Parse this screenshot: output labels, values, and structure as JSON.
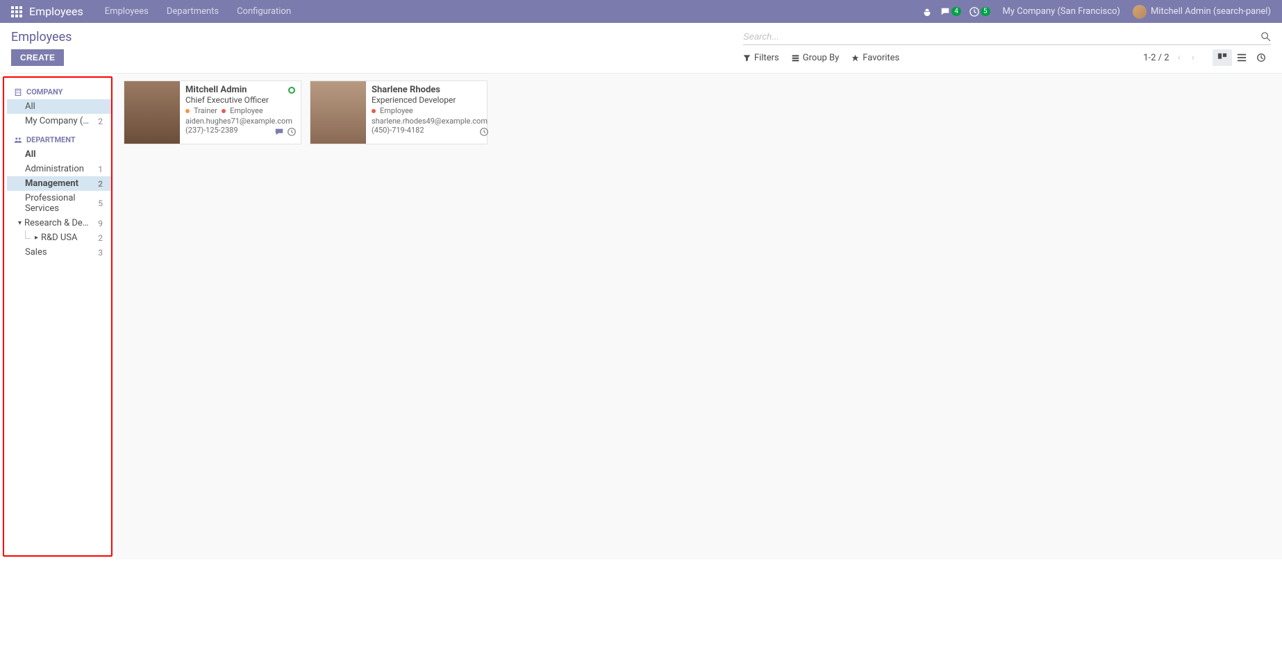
{
  "navbar": {
    "brand": "Employees",
    "links": [
      "Employees",
      "Departments",
      "Configuration"
    ],
    "chat_badge": "4",
    "clock_badge": "5",
    "company": "My Company (San Francisco)",
    "user": "Mitchell Admin (search-panel)"
  },
  "header": {
    "title": "Employees",
    "search_placeholder": "Search...",
    "create_label": "CREATE",
    "filters_label": "Filters",
    "groupby_label": "Group By",
    "favorites_label": "Favorites",
    "pager": "1-2 / 2"
  },
  "sidebar": {
    "company": {
      "head": "COMPANY",
      "items": [
        {
          "label": "All",
          "count": ""
        },
        {
          "label": "My Company (San Fr…",
          "count": "2"
        }
      ]
    },
    "department": {
      "head": "DEPARTMENT",
      "items": [
        {
          "label": "All",
          "count": ""
        },
        {
          "label": "Administration",
          "count": "1"
        },
        {
          "label": "Management",
          "count": "2"
        },
        {
          "label": "Professional Services",
          "count": "5"
        },
        {
          "label": "Research & Develop…",
          "count": "9"
        },
        {
          "label": "R&D USA",
          "count": "2"
        },
        {
          "label": "Sales",
          "count": "3"
        }
      ]
    }
  },
  "cards": [
    {
      "name": "Mitchell Admin",
      "title": "Chief Executive Officer",
      "tags": [
        {
          "color": "orange",
          "text": "Trainer"
        },
        {
          "color": "red",
          "text": "Employee"
        }
      ],
      "email": "aiden.hughes71@example.com",
      "phone": "(237)-125-2389",
      "presence": true,
      "has_chat": true
    },
    {
      "name": "Sharlene Rhodes",
      "title": "Experienced Developer",
      "tags": [
        {
          "color": "red",
          "text": "Employee"
        }
      ],
      "email": "sharlene.rhodes49@example.com",
      "phone": "(450)-719-4182",
      "presence": false,
      "has_chat": false
    }
  ]
}
